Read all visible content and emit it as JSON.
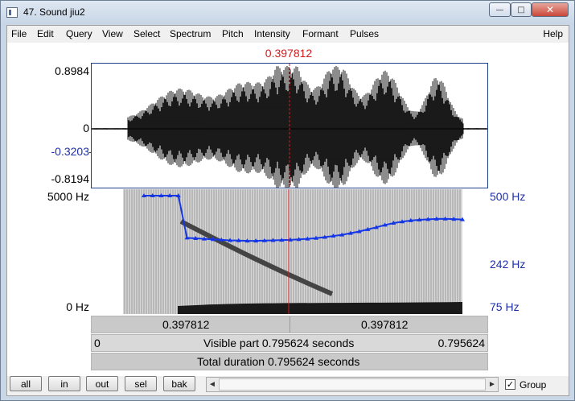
{
  "window": {
    "title": "47. Sound jiu2",
    "minimize_glyph": "—",
    "maximize_glyph": "□",
    "close_glyph": "✕"
  },
  "menu": {
    "items": [
      "File",
      "Edit",
      "Query",
      "View",
      "Select",
      "Spectrum",
      "Pitch",
      "Intensity",
      "Formant",
      "Pulses"
    ],
    "help": "Help"
  },
  "cursor": {
    "time": "0.397812"
  },
  "waveform": {
    "max": "0.8984",
    "zero": "0",
    "cursor_value": "-0.3203",
    "min": "-0.8194"
  },
  "spectrogram": {
    "top_freq": "5000 Hz",
    "bottom_freq": "0 Hz",
    "pitch_top": "500 Hz",
    "pitch_cursor": "242 Hz",
    "pitch_bottom": "75 Hz",
    "pitch_track_hz": [
      500,
      500,
      500,
      500,
      500,
      242,
      240,
      238,
      236,
      234,
      232,
      231,
      230,
      230,
      231,
      232,
      233,
      234,
      236,
      238,
      241,
      245,
      250,
      255,
      262,
      270,
      280,
      290,
      302,
      312,
      320,
      326,
      330,
      333,
      335,
      336,
      334,
      332
    ]
  },
  "timebars": {
    "left_time": "0.397812",
    "right_time": "0.397812",
    "visible_start": "0",
    "visible_text": "Visible part 0.795624 seconds",
    "visible_end": "0.795624",
    "total_text": "Total duration 0.795624 seconds"
  },
  "bottom": {
    "buttons": [
      "all",
      "in",
      "out",
      "sel",
      "bak"
    ],
    "scroll_left": "◄",
    "scroll_right": "►",
    "group_label": "Group",
    "group_checked": true,
    "check_glyph": "✓"
  },
  "colors": {
    "cursor": "#d11d1d",
    "pitch": "#1f2fa8",
    "pitch_track": "#1436e6",
    "waveform": "#000000"
  }
}
